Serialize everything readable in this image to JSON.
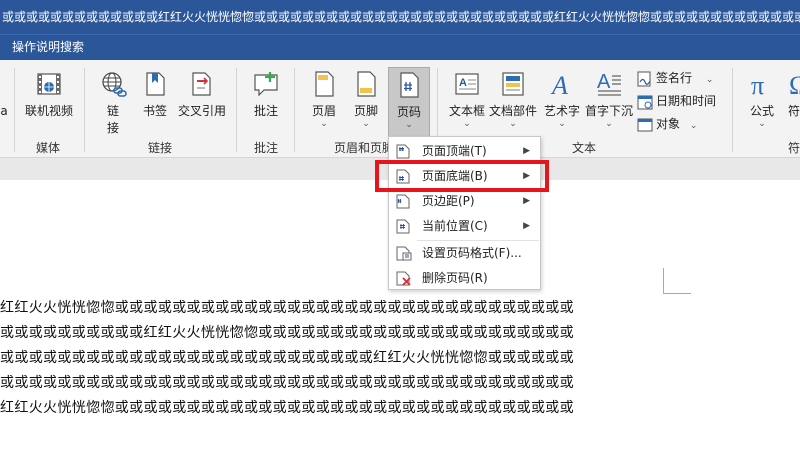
{
  "titlebar": {
    "text": "或或或或或或或或或或或或或红红火火恍恍惚惚或或或或或或或或或或或或或或或或或或或或或或或或或红红火火恍恍惚惚或或或或或或或或或或或或或或或或或或或或或或或或红红火火恍恍惚惚"
  },
  "tellbar": {
    "label": "操作说明搜索"
  },
  "ribbon": {
    "groups": {
      "media": "媒体",
      "links": "链接",
      "comments": "批注",
      "header_footer": "页眉和页脚",
      "text": "文本",
      "symbols": "符"
    },
    "buttons": {
      "partial_left": "a",
      "online_video": "联机视频",
      "link_line1": "链",
      "link_line2": "接",
      "bookmark": "书签",
      "cross_ref": "交叉引用",
      "comment": "批注",
      "header": "页眉",
      "footer": "页脚",
      "page_number": "页码",
      "text_box": "文本框",
      "doc_parts": "文档部件",
      "wordart": "艺术字",
      "drop_cap": "首字下沉",
      "signature": "签名行",
      "datetime": "日期和时间",
      "object": "对象",
      "equation": "公式",
      "symbol_partial": "符"
    },
    "dropdown_glyph": "⌄"
  },
  "menu": {
    "items": [
      {
        "label": "页面顶端(T)",
        "submenu": true
      },
      {
        "label": "页面底端(B)",
        "submenu": true
      },
      {
        "label": "页边距(P)",
        "submenu": true
      },
      {
        "label": "当前位置(C)",
        "submenu": true
      },
      {
        "label": "设置页码格式(F)...",
        "submenu": false
      },
      {
        "label": "删除页码(R)",
        "submenu": false
      }
    ],
    "arrow_glyph": "▶"
  },
  "document": {
    "lines": [
      "红红火火恍恍惚惚或或或或或或或或或或或或或或或或或或或或或或或或或或或或或或或或",
      "或或或或或或或或或或红红火火恍恍惚惚或或或或或或或或或或或或或或或或或或或或或或",
      "或或或或或或或或或或或或或或或或或或或或或或或或或或红红火火恍恍惚惚或或或或或或",
      "或或或或或或或或或或或或或或或或或或或或或或或或或或或或或或或或或或或或或或或或",
      "红红火火恍恍惚惚或或或或或或或或或或或或或或或或或或或或或或或或或或或或或或或或"
    ]
  },
  "colors": {
    "title_blue": "#2b579a",
    "highlight_red": "#e8141b",
    "accent_blue": "#2b6cb3"
  }
}
